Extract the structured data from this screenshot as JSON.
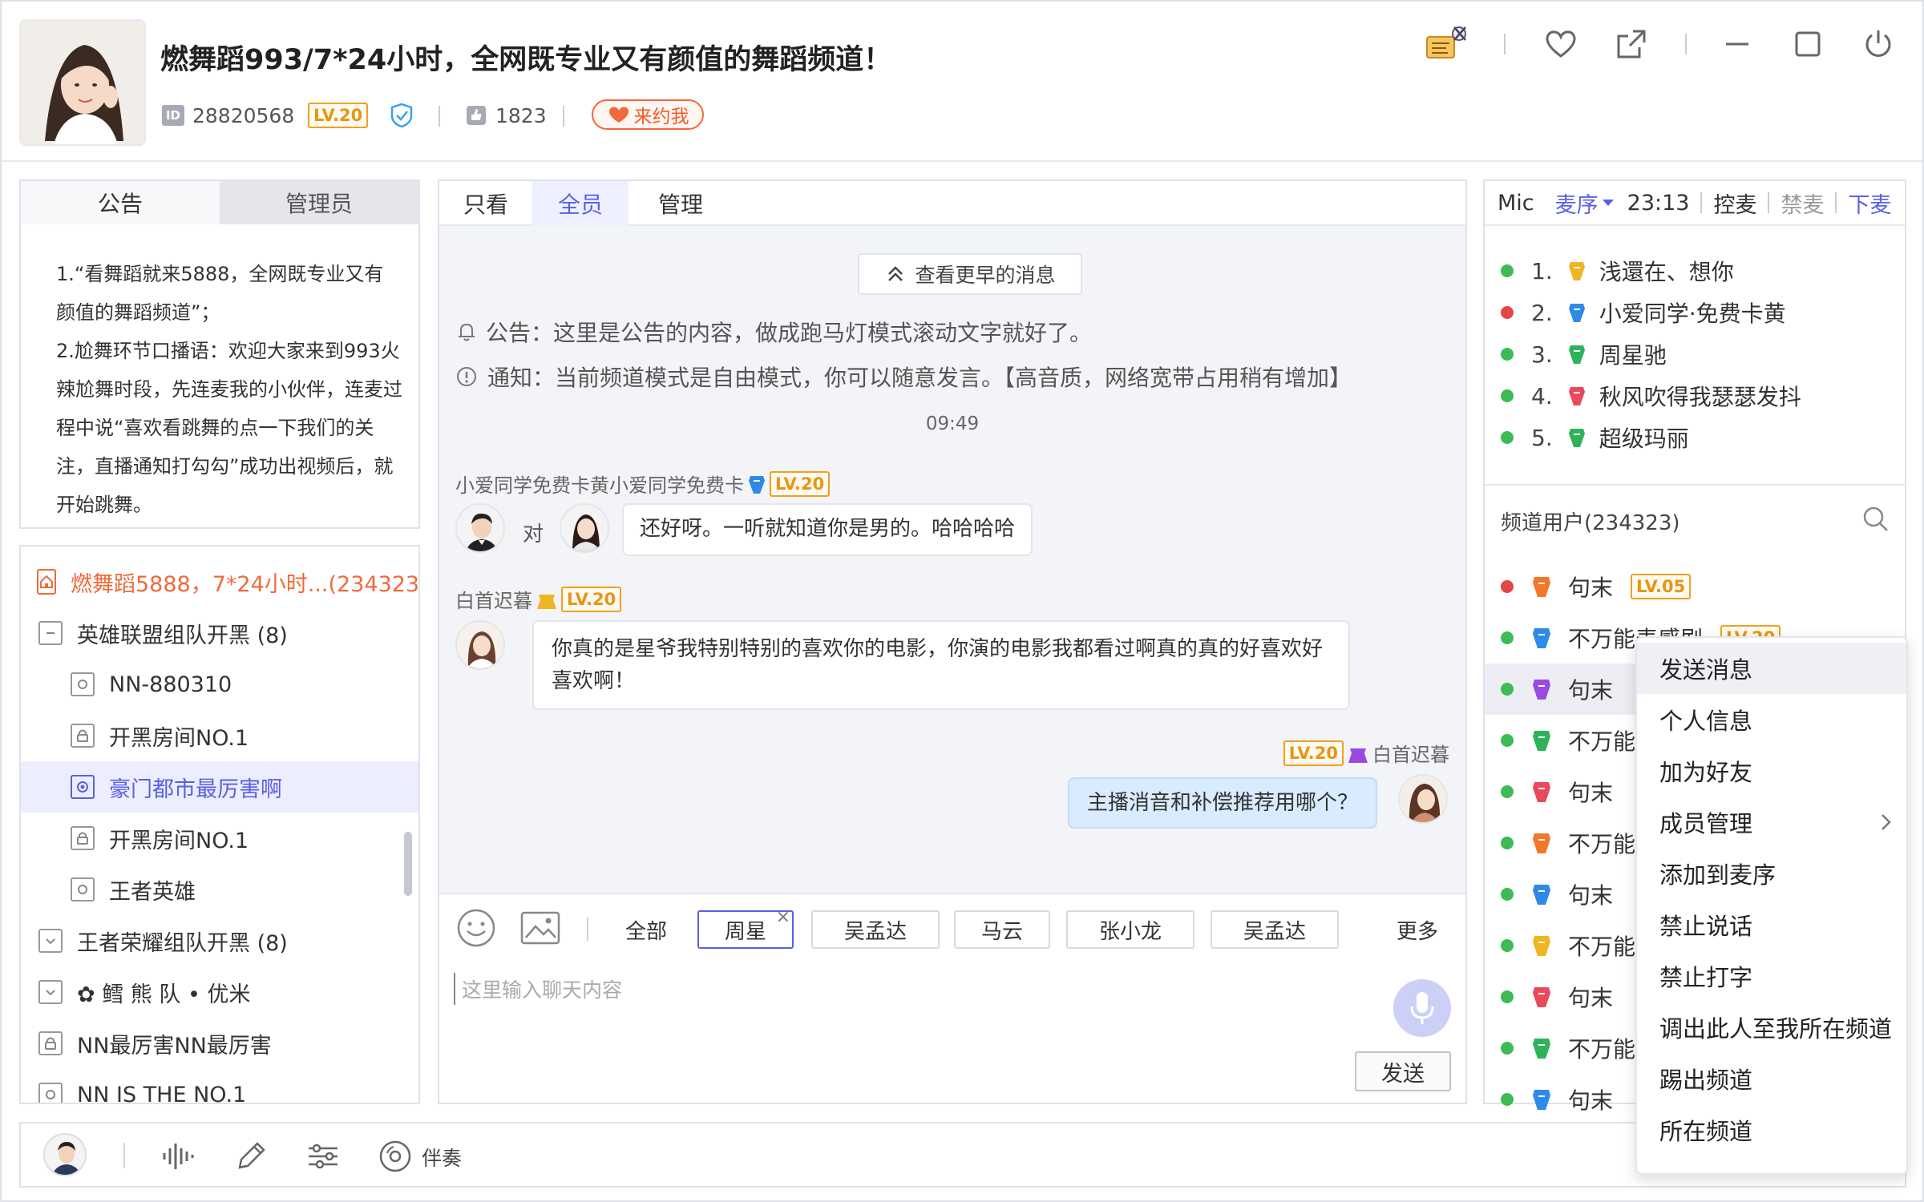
{
  "header": {
    "title": "燃舞蹈993/7*24小时，全网既专业又有颜值的舞蹈频道！",
    "id_label": "ID",
    "id_value": "28820568",
    "level": "LV.20",
    "fans": "1823",
    "date_button": "来约我"
  },
  "notice_tabs": [
    "公告",
    "管理员"
  ],
  "notice": {
    "lines": [
      "1.“看舞蹈就来5888，全网既专业又有",
      "颜值的舞蹈频道”；",
      "2.尬舞环节口播语：欢迎大家来到993火",
      "辣尬舞时段，先连麦我的小伙伴，连麦过",
      "程中说“喜欢看跳舞的点一下我们的关",
      "注，直播通知打勾勾”成功出视频后，就",
      "开始跳舞。"
    ]
  },
  "tree": {
    "root": "燃舞蹈5888，7*24小时...(234323)",
    "items": [
      {
        "label": "英雄联盟组队开黑 (8)",
        "type": "group-open"
      },
      {
        "label": "NN-880310",
        "type": "room"
      },
      {
        "label": "开黑房间NO.1",
        "type": "locked"
      },
      {
        "label": "豪门都市最厉害啊",
        "type": "active"
      },
      {
        "label": "开黑房间NO.1",
        "type": "locked"
      },
      {
        "label": "王者英雄",
        "type": "room"
      },
      {
        "label": "王者荣耀组队开黑 (8)",
        "type": "group-closed"
      },
      {
        "label": "✿ 鳕 熊 队 • 优米",
        "type": "group-closed"
      },
      {
        "label": "NN最厉害NN最厉害",
        "type": "locked"
      },
      {
        "label": "NN IS THE NO.1",
        "type": "room"
      }
    ]
  },
  "chat": {
    "tabs": [
      "只看",
      "全员",
      "管理"
    ],
    "more_messages": "查看更早的消息",
    "announcement": "公告：这里是公告的内容，做成跑马灯模式滚动文字就好了。",
    "notification": "通知：当前频道模式是自由模式，你可以随意发言。【高音质，网络宽带占用稍有增加】",
    "time": "09:49",
    "msg1_user": "小爱同学免费卡黄小爱同学免费卡",
    "msg1_level": "LV.20",
    "msg1_to": "对",
    "msg1_text": "还好呀。一听就知道你是男的。哈哈哈哈",
    "msg2_user": "白首迟暮",
    "msg2_level": "LV.20",
    "msg2_line1": "你真的是星爷我特别特别的喜欢你的电影，你演的电影我都看过啊真的真的好喜欢好",
    "msg2_line2": "喜欢啊！",
    "msg3_user": "白首迟暮",
    "msg3_level": "LV.20",
    "msg3_text": "主播消音和补偿推荐用哪个？",
    "chip_all": "全部",
    "chips": [
      "周星",
      "吴孟达",
      "马云",
      "张小龙",
      "吴孟达"
    ],
    "chip_close": "×",
    "chip_more": "更多",
    "input_placeholder": "这里输入聊天内容",
    "send": "发送"
  },
  "mic": {
    "label": "Mic",
    "order": "麦序",
    "time": "23:13",
    "control": "控麦",
    "ban": "禁麦",
    "leave": "下麦",
    "list": [
      {
        "num": "1.",
        "name": "浅還在、想你",
        "dot": "#3dbb55",
        "badge": "#f0b522"
      },
      {
        "num": "2.",
        "name": "小爱同学·免费卡黄",
        "dot": "#e24646",
        "badge": "#2d8ae8"
      },
      {
        "num": "3.",
        "name": "周星驰",
        "dot": "#3dbb55",
        "badge": "#2fb35a"
      },
      {
        "num": "4.",
        "name": "秋风吹得我瑟瑟发抖",
        "dot": "#3dbb55",
        "badge": "#e84a5c"
      },
      {
        "num": "5.",
        "name": "超级玛丽",
        "dot": "#3dbb55",
        "badge": "#2fb35a"
      }
    ]
  },
  "users": {
    "title": "频道用户(234323)",
    "list": [
      {
        "name": "句末",
        "dot": "#e24646",
        "badge": "#f2772a",
        "level": "LV.05"
      },
      {
        "name": "不万能表感剧",
        "dot": "#3dbb55",
        "badge": "#2d8ae8",
        "level": "LV.20"
      },
      {
        "name": "句末",
        "dot": "#3dbb55",
        "badge": "#9a4ae0",
        "level": ""
      },
      {
        "name": "不万能",
        "dot": "#3dbb55",
        "badge": "#2fb35a",
        "level": ""
      },
      {
        "name": "句末",
        "dot": "#3dbb55",
        "badge": "#e84a5c",
        "level": ""
      },
      {
        "name": "不万能",
        "dot": "#3dbb55",
        "badge": "#f2772a",
        "level": ""
      },
      {
        "name": "句末",
        "dot": "#3dbb55",
        "badge": "#2d8ae8",
        "level": ""
      },
      {
        "name": "不万能",
        "dot": "#3dbb55",
        "badge": "#f0b522",
        "level": ""
      },
      {
        "name": "句末",
        "dot": "#3dbb55",
        "badge": "#e84a5c",
        "level": ""
      },
      {
        "name": "不万能",
        "dot": "#3dbb55",
        "badge": "#2fb35a",
        "level": ""
      },
      {
        "name": "句末",
        "dot": "#3dbb55",
        "badge": "#2d8ae8",
        "level": ""
      }
    ]
  },
  "context_menu": {
    "items": [
      "发送消息",
      "个人信息",
      "加为好友",
      "成员管理",
      "添加到麦序",
      "禁止说话",
      "禁止打字",
      "调出此人至我所在频道",
      "踢出频道",
      "所在频道"
    ]
  },
  "bottom_bar": {
    "accompany": "伴奏"
  },
  "colors": {
    "accent": "#5a5fe6",
    "orange": "#f06a3a",
    "level": "#e79514",
    "online": "#3dbb55",
    "busy": "#e24646"
  }
}
